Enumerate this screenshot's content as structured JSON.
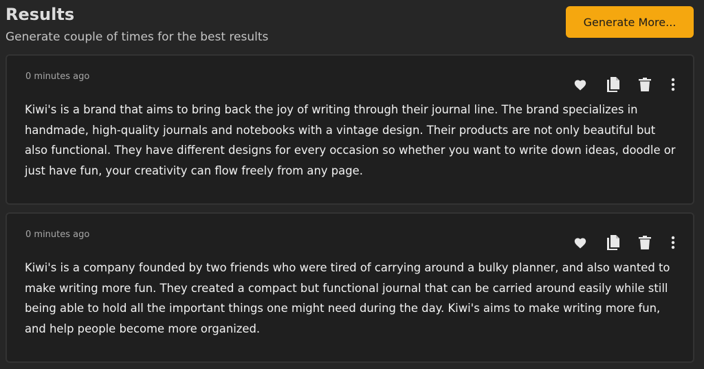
{
  "header": {
    "title": "Results",
    "subtitle": "Generate couple of times for the best results",
    "generate_button_label": "Generate More..."
  },
  "results": [
    {
      "timestamp": "0 minutes ago",
      "text": "Kiwi's is a brand that aims to bring back the joy of writing through their journal line. The brand specializes in handmade, high-quality journals and notebooks with a vintage design. Their products are not only beautiful but also functional. They have different designs for every occasion so whether you want to write down ideas, doodle or just have fun, your creativity can flow freely from any page.",
      "actions": [
        "heart-icon",
        "copy-icon",
        "trash-icon",
        "more-vertical-icon"
      ]
    },
    {
      "timestamp": "0 minutes ago",
      "text": "Kiwi's is a company founded by two friends who were tired of carrying around a bulky planner, and also wanted to make writing more fun. They created a compact but functional journal that can be carried around easily while still being able to hold all the important things one might need during the day. Kiwi's aims to make writing more fun, and help people become more organized.",
      "actions": [
        "heart-icon",
        "copy-icon",
        "trash-icon",
        "more-vertical-icon"
      ]
    }
  ],
  "colors": {
    "background": "#262626",
    "card_background": "#1f1f1f",
    "accent": "#f5a70f",
    "text": "#f2f2f2"
  }
}
